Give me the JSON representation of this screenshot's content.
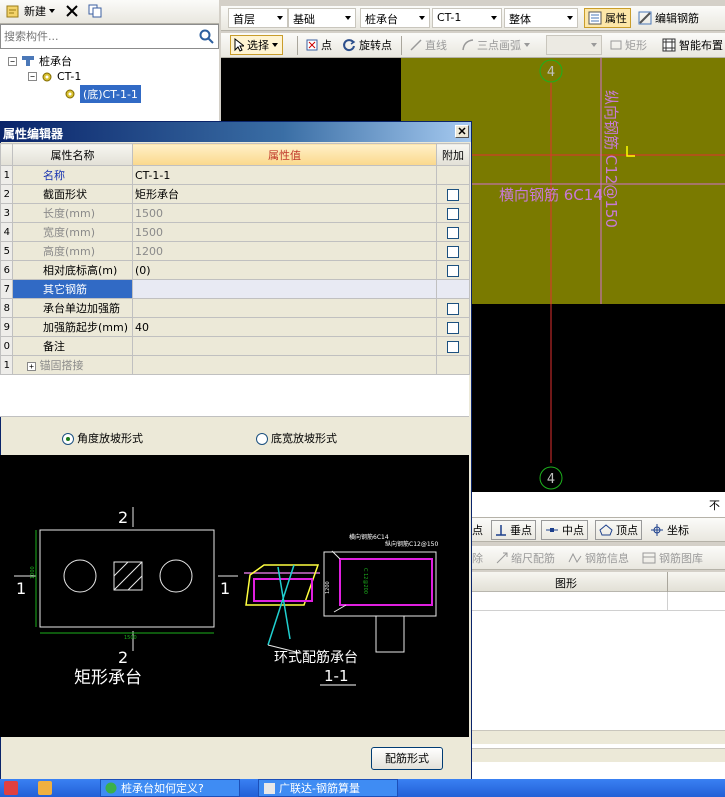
{
  "toolbar": {
    "new_label": "新建",
    "search_placeholder": "搜索构件..."
  },
  "tree": {
    "root": "桩承台",
    "child": "CT-1",
    "leaf": "(底)CT-1-1"
  },
  "floor_combo": "首层",
  "category_combo": "基础",
  "type_combo": "桩承台",
  "member_combo": "CT-1",
  "scope_combo": "整体",
  "right_toolbar": {
    "props": "属性",
    "edit_rebar": "编辑钢筋",
    "select": "选择",
    "point": "点",
    "rotate_point": "旋转点",
    "line": "直线",
    "arc": "三点画弧",
    "rect": "矩形",
    "smart_layout": "智能布置"
  },
  "dialog": {
    "title": "属性编辑器",
    "col_name": "属性名称",
    "col_value": "属性值",
    "col_extra": "附加",
    "rows": [
      {
        "no": "1",
        "name": "名称",
        "value": "CT-1-1"
      },
      {
        "no": "2",
        "name": "截面形状",
        "value": "矩形承台"
      },
      {
        "no": "3",
        "name": "长度(mm)",
        "value": "1500"
      },
      {
        "no": "4",
        "name": "宽度(mm)",
        "value": "1500"
      },
      {
        "no": "5",
        "name": "高度(mm)",
        "value": "1200"
      },
      {
        "no": "6",
        "name": "相对底标高(m)",
        "value": "(0)"
      },
      {
        "no": "7",
        "name": "其它钢筋",
        "value": ""
      },
      {
        "no": "8",
        "name": "承台单边加强筋",
        "value": ""
      },
      {
        "no": "9",
        "name": "加强筋起步(mm)",
        "value": "40"
      },
      {
        "no": "0",
        "name": "备注",
        "value": ""
      },
      {
        "no": "1",
        "name": "锚固搭接",
        "value": ""
      }
    ],
    "radio_angle": "角度放坡形式",
    "radio_width": "底宽放坡形式",
    "rebar_button": "配筋形式"
  },
  "cad": {
    "axis_label": "4",
    "axis_label_bottom": "4",
    "horiz_rebar": "横向钢筋 6C14",
    "vert_rebar": "纵向钢筋 C12@150"
  },
  "figure": {
    "section_no_top": "2",
    "section_no_bottom": "2",
    "section_no_left": "1",
    "section_no_right": "1",
    "dim_width": "1500",
    "dim_height": "1000",
    "plan_title": "矩形承台",
    "section_title": "环式配筋承台",
    "section_id": "1-1",
    "label_h": "横向钢筋6C14",
    "label_v": "纵向钢筋C12@150",
    "label_side": "C 12@200",
    "dim_side": "1200"
  },
  "snap_bar": {
    "off_prefix": "不",
    "point": "点",
    "perp": "垂点",
    "mid": "中点",
    "vertex": "顶点",
    "coord": "坐标"
  },
  "rebar_bar": {
    "del": "除",
    "scale": "缩尺配筋",
    "info": "钢筋信息",
    "lib": "钢筋图库"
  },
  "rebar_table": {
    "col_shape": "图形"
  },
  "taskbar": {
    "item1": "桩承台如何定义?",
    "item2": "广联达-钢筋算量"
  },
  "colors": {
    "cad_bg": "#000000",
    "footing_fill": "#7a7a00",
    "axis_red": "#e23030",
    "rebar_pink": "#d070d0",
    "select_blue": "#316ac5",
    "header_orange": "#f5c463"
  }
}
